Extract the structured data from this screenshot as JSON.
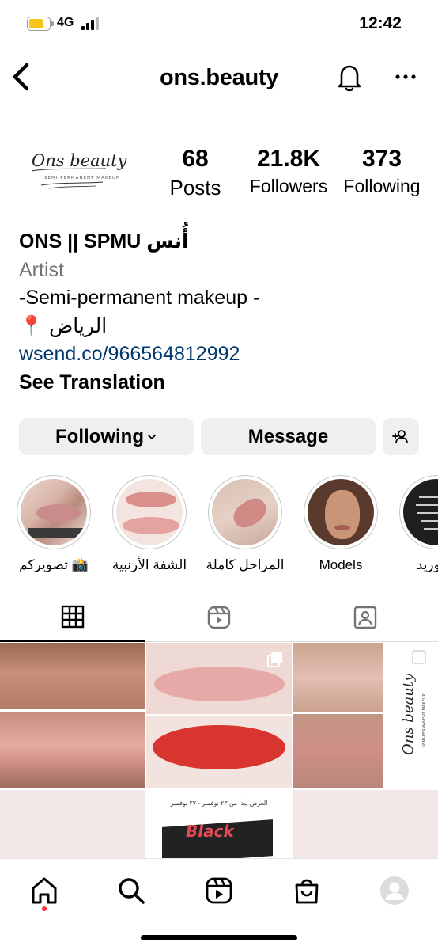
{
  "status_bar": {
    "network": "4G",
    "time": "12:42",
    "battery_level": 0.6,
    "battery_color": "#f5c518"
  },
  "header": {
    "username": "ons.beauty"
  },
  "profile": {
    "logo_text": "Ons beauty",
    "logo_subtext": "SEMI-PERMANENT MAKEUP",
    "stats": [
      {
        "value": "68",
        "label": "Posts"
      },
      {
        "value": "21.8K",
        "label": "Followers"
      },
      {
        "value": "373",
        "label": "Following"
      }
    ],
    "name": "ONS || SPMU أُنس",
    "category": "Artist",
    "bio_lines": [
      "-Semi-permanent makeup -",
      "📍 الرياض"
    ],
    "link": "wsend.co/966564812992",
    "see_translation": "See Translation"
  },
  "actions": {
    "following_label": "Following",
    "message_label": "Message"
  },
  "highlights": [
    {
      "label": "تصويركم 📸"
    },
    {
      "label": "الشفة الأرنبية"
    },
    {
      "label": "المراحل كاملة"
    },
    {
      "label": "Models"
    },
    {
      "label": "التوريد/"
    }
  ],
  "grid": {
    "banner_text": "العرض يبدأ من ٢٣ نوفمبر - ٢٧ نوفمبر",
    "black_text": "Black",
    "logo_text": "Ons beauty",
    "logo_subtext": "SEMI-PERMANENT MAKEUP"
  },
  "colors": {
    "link": "#00376b",
    "secondary_text": "#737373",
    "button_bg": "#efefef",
    "notification_dot": "#ff3040"
  }
}
